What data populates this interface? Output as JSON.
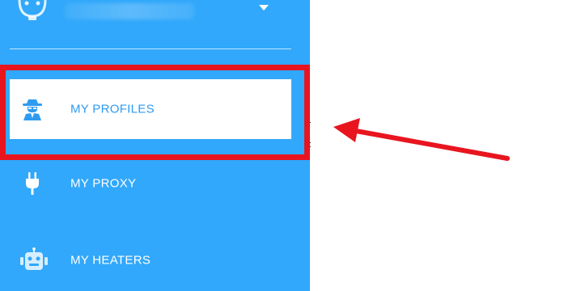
{
  "sidebar": {
    "colors": {
      "background": "#31a8fb",
      "active_background": "#ffffff",
      "active_text": "#2e9bf0",
      "text": "#ffffff",
      "annotation": "#e8151f"
    },
    "user": {
      "avatar_icon": "robot-face-icon",
      "menu_icon": "caret-down-icon"
    },
    "items": [
      {
        "label": "MY PROFILES",
        "icon": "spy-agent-icon",
        "active": true
      },
      {
        "label": "MY PROXY",
        "icon": "plug-icon",
        "active": false
      },
      {
        "label": "MY HEATERS",
        "icon": "robot-icon",
        "active": false
      }
    ]
  }
}
